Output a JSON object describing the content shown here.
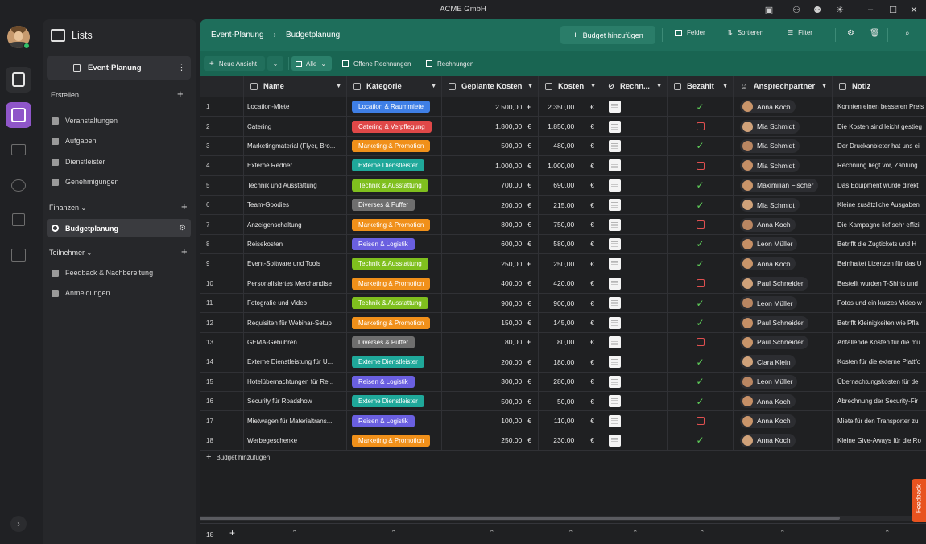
{
  "window": {
    "title": "ACME GmbH"
  },
  "sidebar": {
    "app_title": "Lists",
    "workspace": "Event-Planung",
    "sections": [
      {
        "title": "Erstellen",
        "items": [
          "Veranstaltungen",
          "Aufgaben",
          "Dienstleister",
          "Genehmigungen"
        ]
      },
      {
        "title": "Finanzen",
        "items": [
          "Budgetplanung"
        ]
      },
      {
        "title": "Teilnehmer",
        "items": [
          "Feedback & Nachbereitung",
          "Anmeldungen"
        ]
      }
    ],
    "active_item": "Budgetplanung"
  },
  "header": {
    "breadcrumb": [
      "Event-Planung",
      "Budgetplanung"
    ],
    "add_button": "Budget hinzufügen",
    "fields": "Felder",
    "sort": "Sortieren",
    "filter": "Filter"
  },
  "toolbar": {
    "new_view": "Neue Ansicht",
    "views": [
      "Alle",
      "Offene Rechnungen",
      "Rechnungen"
    ]
  },
  "table": {
    "columns": [
      "Name",
      "Kategorie",
      "Geplante Kosten",
      "Kosten",
      "Rechn...",
      "Bezahlt",
      "Ansprechpartner",
      "Notiz"
    ],
    "currency": "€",
    "rows": [
      {
        "num": "1",
        "name": "Location-Miete",
        "cat": "Location & Raummiete",
        "planned": "2.500,00",
        "cost": "2.350,00",
        "paid": true,
        "contact": "Anna Koch",
        "note": "Konnten einen besseren Preis"
      },
      {
        "num": "2",
        "name": "Catering",
        "cat": "Catering & Verpflegung",
        "planned": "1.800,00",
        "cost": "1.850,00",
        "paid": false,
        "contact": "Mia Schmidt",
        "note": "Die Kosten sind leicht gestieg"
      },
      {
        "num": "3",
        "name": "Marketingmaterial (Flyer, Bro...",
        "cat": "Marketing & Promotion",
        "planned": "500,00",
        "cost": "480,00",
        "paid": true,
        "contact": "Mia Schmidt",
        "note": "Der Druckanbieter hat uns ei"
      },
      {
        "num": "4",
        "name": "Externe Redner",
        "cat": "Externe Dienstleister",
        "planned": "1.000,00",
        "cost": "1.000,00",
        "paid": false,
        "contact": "Mia Schmidt",
        "note": "Rechnung liegt vor, Zahlung"
      },
      {
        "num": "5",
        "name": "Technik und Ausstattung",
        "cat": "Technik & Ausstattung",
        "planned": "700,00",
        "cost": "690,00",
        "paid": true,
        "contact": "Maximilian Fischer",
        "note": "Das Equipment wurde direkt"
      },
      {
        "num": "6",
        "name": "Team-Goodies",
        "cat": "Diverses & Puffer",
        "planned": "200,00",
        "cost": "215,00",
        "paid": true,
        "contact": "Mia Schmidt",
        "note": "Kleine zusätzliche Ausgaben"
      },
      {
        "num": "7",
        "name": "Anzeigenschaltung",
        "cat": "Marketing & Promotion",
        "planned": "800,00",
        "cost": "750,00",
        "paid": false,
        "contact": "Anna Koch",
        "note": "Die Kampagne lief sehr effizi"
      },
      {
        "num": "8",
        "name": "Reisekosten",
        "cat": "Reisen & Logistik",
        "planned": "600,00",
        "cost": "580,00",
        "paid": true,
        "contact": "Leon Müller",
        "note": "Betrifft die Zugtickets und H"
      },
      {
        "num": "9",
        "name": "Event-Software und Tools",
        "cat": "Technik & Ausstattung",
        "planned": "250,00",
        "cost": "250,00",
        "paid": true,
        "contact": "Anna Koch",
        "note": "Beinhaltet Lizenzen für das U"
      },
      {
        "num": "10",
        "name": "Personalisiertes Merchandise",
        "cat": "Marketing & Promotion",
        "planned": "400,00",
        "cost": "420,00",
        "paid": false,
        "contact": "Paul Schneider",
        "note": "Bestellt wurden T-Shirts und"
      },
      {
        "num": "11",
        "name": "Fotografie und Video",
        "cat": "Technik & Ausstattung",
        "planned": "900,00",
        "cost": "900,00",
        "paid": true,
        "contact": "Leon Müller",
        "note": "Fotos und ein kurzes Video w"
      },
      {
        "num": "12",
        "name": "Requisiten für Webinar-Setup",
        "cat": "Marketing & Promotion",
        "planned": "150,00",
        "cost": "145,00",
        "paid": true,
        "contact": "Paul Schneider",
        "note": "Betrifft Kleinigkeiten wie Pfla"
      },
      {
        "num": "13",
        "name": "GEMA-Gebühren",
        "cat": "Diverses & Puffer",
        "planned": "80,00",
        "cost": "80,00",
        "paid": false,
        "contact": "Paul Schneider",
        "note": "Anfallende Kosten für die mu"
      },
      {
        "num": "14",
        "name": "Externe Dienstleistung für U...",
        "cat": "Externe Dienstleister",
        "planned": "200,00",
        "cost": "180,00",
        "paid": true,
        "contact": "Clara Klein",
        "note": "Kosten für die externe Plattfo"
      },
      {
        "num": "15",
        "name": "Hotelübernachtungen für Re...",
        "cat": "Reisen & Logistik",
        "planned": "300,00",
        "cost": "280,00",
        "paid": true,
        "contact": "Leon Müller",
        "note": "Übernachtungskosten für de"
      },
      {
        "num": "16",
        "name": "Security für Roadshow",
        "cat": "Externe Dienstleister",
        "planned": "500,00",
        "cost": "50,00",
        "paid": true,
        "contact": "Anna Koch",
        "note": "Abrechnung der Security-Fir"
      },
      {
        "num": "17",
        "name": "Mietwagen für Materialtrans...",
        "cat": "Reisen & Logistik",
        "planned": "100,00",
        "cost": "110,00",
        "paid": false,
        "contact": "Anna Koch",
        "note": "Miete für den Transporter zu"
      },
      {
        "num": "18",
        "name": "Werbegeschenke",
        "cat": "Marketing & Promotion",
        "planned": "250,00",
        "cost": "230,00",
        "paid": true,
        "contact": "Anna Koch",
        "note": "Kleine Give-Aways für die Ro"
      }
    ],
    "add_row": "Budget hinzufügen",
    "row_count": "18"
  },
  "category_colors": {
    "Location & Raummiete": "#3f7fe6",
    "Catering & Verpflegung": "#e04848",
    "Marketing & Promotion": "#f0901a",
    "Externe Dienstleister": "#1fa89a",
    "Technik & Ausstattung": "#7fbf1e",
    "Diverses & Puffer": "#6e6e6e",
    "Reisen & Logistik": "#6a5fe0"
  },
  "feedback_tab": "Feedback"
}
